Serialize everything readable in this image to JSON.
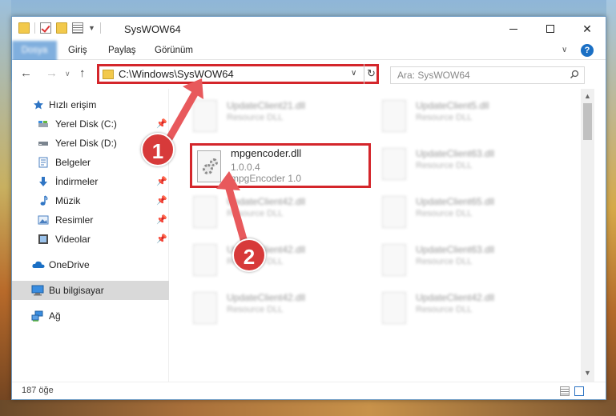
{
  "window": {
    "title": "SysWOW64",
    "controls": {
      "minimize": "Simge durumuna küçült",
      "maximize": "Ekranı kapla",
      "close": "Kapat"
    }
  },
  "ribbon": {
    "tabs": [
      "Dosya",
      "Giriş",
      "Paylaş",
      "Görünüm"
    ],
    "help": "?"
  },
  "navigation": {
    "address": "C:\\Windows\\SysWOW64",
    "search_placeholder": "Ara: SysWOW64"
  },
  "sidebar": {
    "items": [
      {
        "label": "Hızlı erişim",
        "icon": "star-icon"
      },
      {
        "label": "Yerel Disk (C:)",
        "icon": "drive-icon",
        "pinned": true
      },
      {
        "label": "Yerel Disk (D:)",
        "icon": "drive-icon",
        "pinned": true
      },
      {
        "label": "Belgeler",
        "icon": "document-icon",
        "pinned": true
      },
      {
        "label": "İndirmeler",
        "icon": "download-icon",
        "pinned": true
      },
      {
        "label": "Müzik",
        "icon": "music-icon",
        "pinned": true
      },
      {
        "label": "Resimler",
        "icon": "pictures-icon",
        "pinned": true
      },
      {
        "label": "Videolar",
        "icon": "video-icon",
        "pinned": true
      },
      {
        "label": "OneDrive",
        "icon": "cloud-icon"
      },
      {
        "label": "Bu bilgisayar",
        "icon": "computer-icon",
        "selected": true
      },
      {
        "label": "Ağ",
        "icon": "network-icon"
      }
    ]
  },
  "files": [
    {
      "name": "UpdateClient21.dll",
      "desc": "Resource DLL"
    },
    {
      "name": "UpdateClient5.dll",
      "desc": "Resource DLL"
    },
    {
      "name": "UpdateClient63.dll",
      "desc": "Resource DLL"
    },
    {
      "name": "UpdateClient42.dll",
      "desc": "Resource DLL"
    },
    {
      "name": "UpdateClient65.dll",
      "desc": "Resource DLL"
    },
    {
      "name": "UpdateClient42.dll",
      "desc": "Resource DLL"
    },
    {
      "name": "UpdateClient63.dll",
      "desc": "Resource DLL"
    },
    {
      "name": "UpdateClient42.dll",
      "desc": "Resource DLL"
    },
    {
      "name": "UpdateClient42.dll",
      "desc": "Resource DLL"
    }
  ],
  "highlighted_file": {
    "name": "mpgencoder.dll",
    "version": "1.0.0.4",
    "description": "mpgEncoder 1.0"
  },
  "status": {
    "count": "187 öğe"
  },
  "annotations": {
    "badge1": "1",
    "badge2": "2",
    "color": "#d73a3a"
  }
}
